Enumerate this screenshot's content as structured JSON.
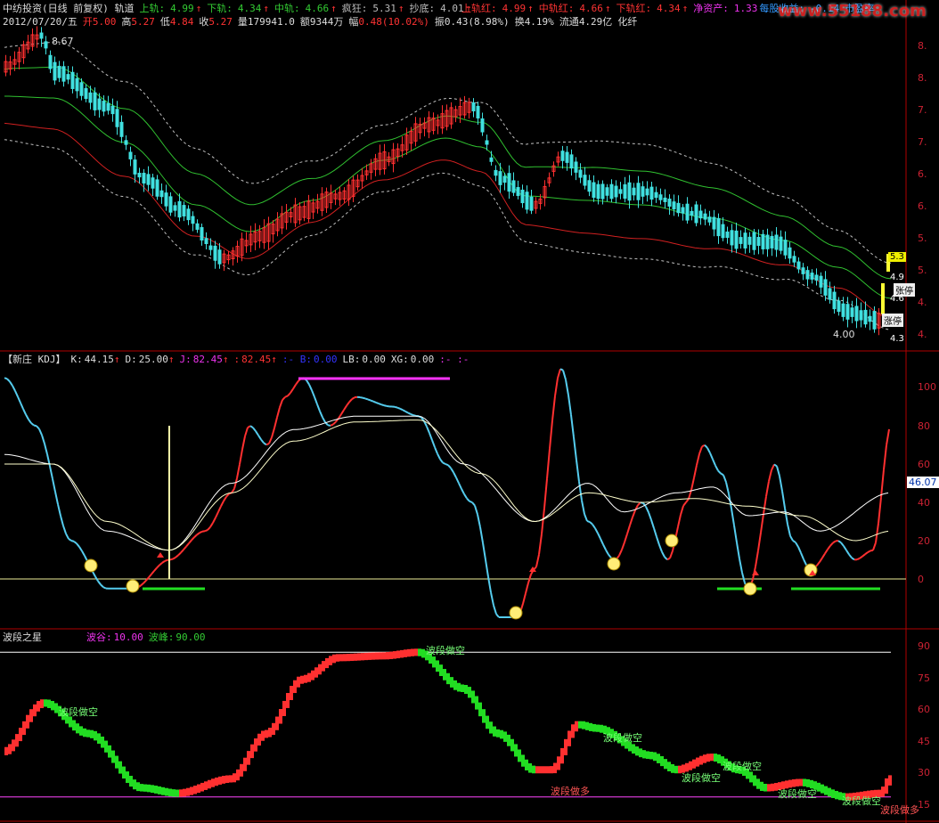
{
  "main": {
    "row1": {
      "name": "中纺投资(日线 前复权) 轨道",
      "upper_label": "上轨:",
      "upper": "4.99",
      "lower_label": "下轨:",
      "lower": "4.34",
      "mid_label": "中轨:",
      "mid": "4.66",
      "crazy_label": "疯狂:",
      "crazy": "5.31",
      "bottom_label": "抄底:",
      "bottom": "4.01",
      "upper_red_label": "上轨红:",
      "upper_red": "4.99",
      "mid_red_label": "中轨红:",
      "mid_red": "4.66",
      "lower_red_label": "下轨红:",
      "lower_red": "4.34",
      "net_asset_label": "净资产:",
      "net_asset": "1.33",
      "eps_label": "每股收益:",
      "eps": "-0.14",
      "pe_label": "市盈率"
    },
    "row2": {
      "date": "2012/07/20/五",
      "open_label": "开",
      "open": "5.00",
      "high_label": "高",
      "high": "5.27",
      "low_label": "低",
      "low": "4.84",
      "close_label": "收",
      "close": "5.27",
      "vol_label": "量",
      "vol": "179941.0",
      "amt_label": "额",
      "amt": "9344万",
      "chg_label": "幅",
      "chg": "0.48(10.02%)",
      "amp_label": "振",
      "amp": "0.43(8.98%)",
      "turn_label": "换",
      "turn": "4.19%",
      "float_label": "流通",
      "float": "4.29亿",
      "sector": "化纤"
    },
    "hi_mark": "8.67",
    "lo_mark": "4.00",
    "right_tags": [
      "5.3",
      "4.9",
      "张停",
      "4.6",
      "涨停",
      "4.3"
    ],
    "y_ticks": [
      "8.",
      "8.",
      "7.",
      "7.",
      "6.",
      "6.",
      "5.",
      "5.",
      "4.",
      "4."
    ]
  },
  "kdj": {
    "title": "【新庄 KDJ】",
    "k_label": "K:",
    "k": "44.15",
    "d_label": "D:",
    "d": "25.00",
    "j_label": "J:",
    "j": "82.45",
    "x_label": ":",
    "x": "82.45",
    "b_label": ":-  B:",
    "b": "0.00",
    "lb_label": "LB:",
    "lb": "0.00",
    "xg_label": "XG:",
    "xg": "0.00",
    "tail": ":- :-",
    "y_ticks": [
      "100",
      "80",
      "60",
      "40",
      "20",
      "0"
    ],
    "current_value": "46.07"
  },
  "wave": {
    "title": "波段之星",
    "valley_label": "波谷:",
    "valley": "10.00",
    "peak_label": "波峰:",
    "peak": "90.00",
    "y_ticks": [
      "90",
      "75",
      "60",
      "45",
      "30",
      "15"
    ],
    "short_label": "波段做空",
    "long_label": "波段做多"
  },
  "watermark": "www.55188.com",
  "colors": {
    "bg": "#000000",
    "frame": "#b00000",
    "up": "#ff3030",
    "down": "#40e0e0",
    "green_line": "#30d030",
    "red_line": "#d02020",
    "dash": "#c0c0c0",
    "magenta": "#ff33ff",
    "yellow": "#ffff33",
    "green_bar": "#22dd22"
  }
}
